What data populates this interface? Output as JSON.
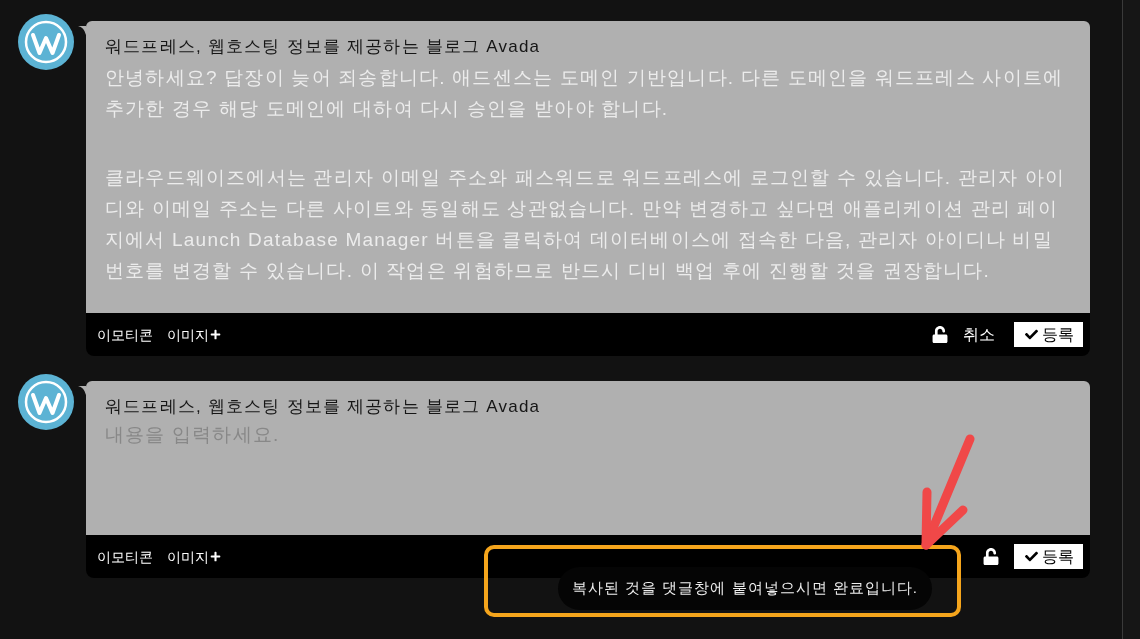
{
  "comments": [
    {
      "author": "워드프레스, 웹호스팅 정보를 제공하는 블로그 Avada",
      "editor": {
        "paragraphs": [
          "안녕하세요? 답장이 늦어 죄송합니다. 애드센스는 도메인 기반입니다. 다른 도메인을 워드프레스 사이트에 추가한 경우 해당 도메인에 대하여 다시 승인을 받아야 합니다.",
          "클라우드웨이즈에서는 관리자 이메일 주소와 패스워드로 워드프레스에 로그인할 수 있습니다. 관리자 아이디와 이메일 주소는 다른 사이트와 동일해도 상관없습니다. 만약 변경하고 싶다면 애플리케이션 관리 페이지에서 Launch Database Manager 버튼을 클릭하여 데이터베이스에 접속한 다음, 관리자 아이디나 비밀번호를 변경할 수 있습니다. 이 작업은 위험하므로 반드시 디비 백업 후에 진행할 것을 권장합니다."
        ]
      },
      "toolbar": {
        "tools": [
          {
            "kind": "text",
            "label": "이모티콘"
          },
          {
            "kind": "add",
            "label": "이미지"
          }
        ],
        "secret": false,
        "cancel": "취소",
        "submit": "등록"
      }
    },
    {
      "author": "워드프레스, 웹호스팅 정보를 제공하는 블로그 Avada",
      "editor": {
        "placeholder": "내용을 입력하세요."
      },
      "toolbar": {
        "tools": [
          {
            "kind": "text",
            "label": "이모티콘"
          },
          {
            "kind": "add",
            "label": "이미지"
          }
        ],
        "secret": false,
        "submit": "등록"
      }
    }
  ],
  "toast": {
    "text": "복사된 것을 댓글창에 붙여넣으시면 완료입니다."
  },
  "annotations": [
    {
      "kind": "highlight"
    },
    {
      "kind": "arrow"
    }
  ]
}
